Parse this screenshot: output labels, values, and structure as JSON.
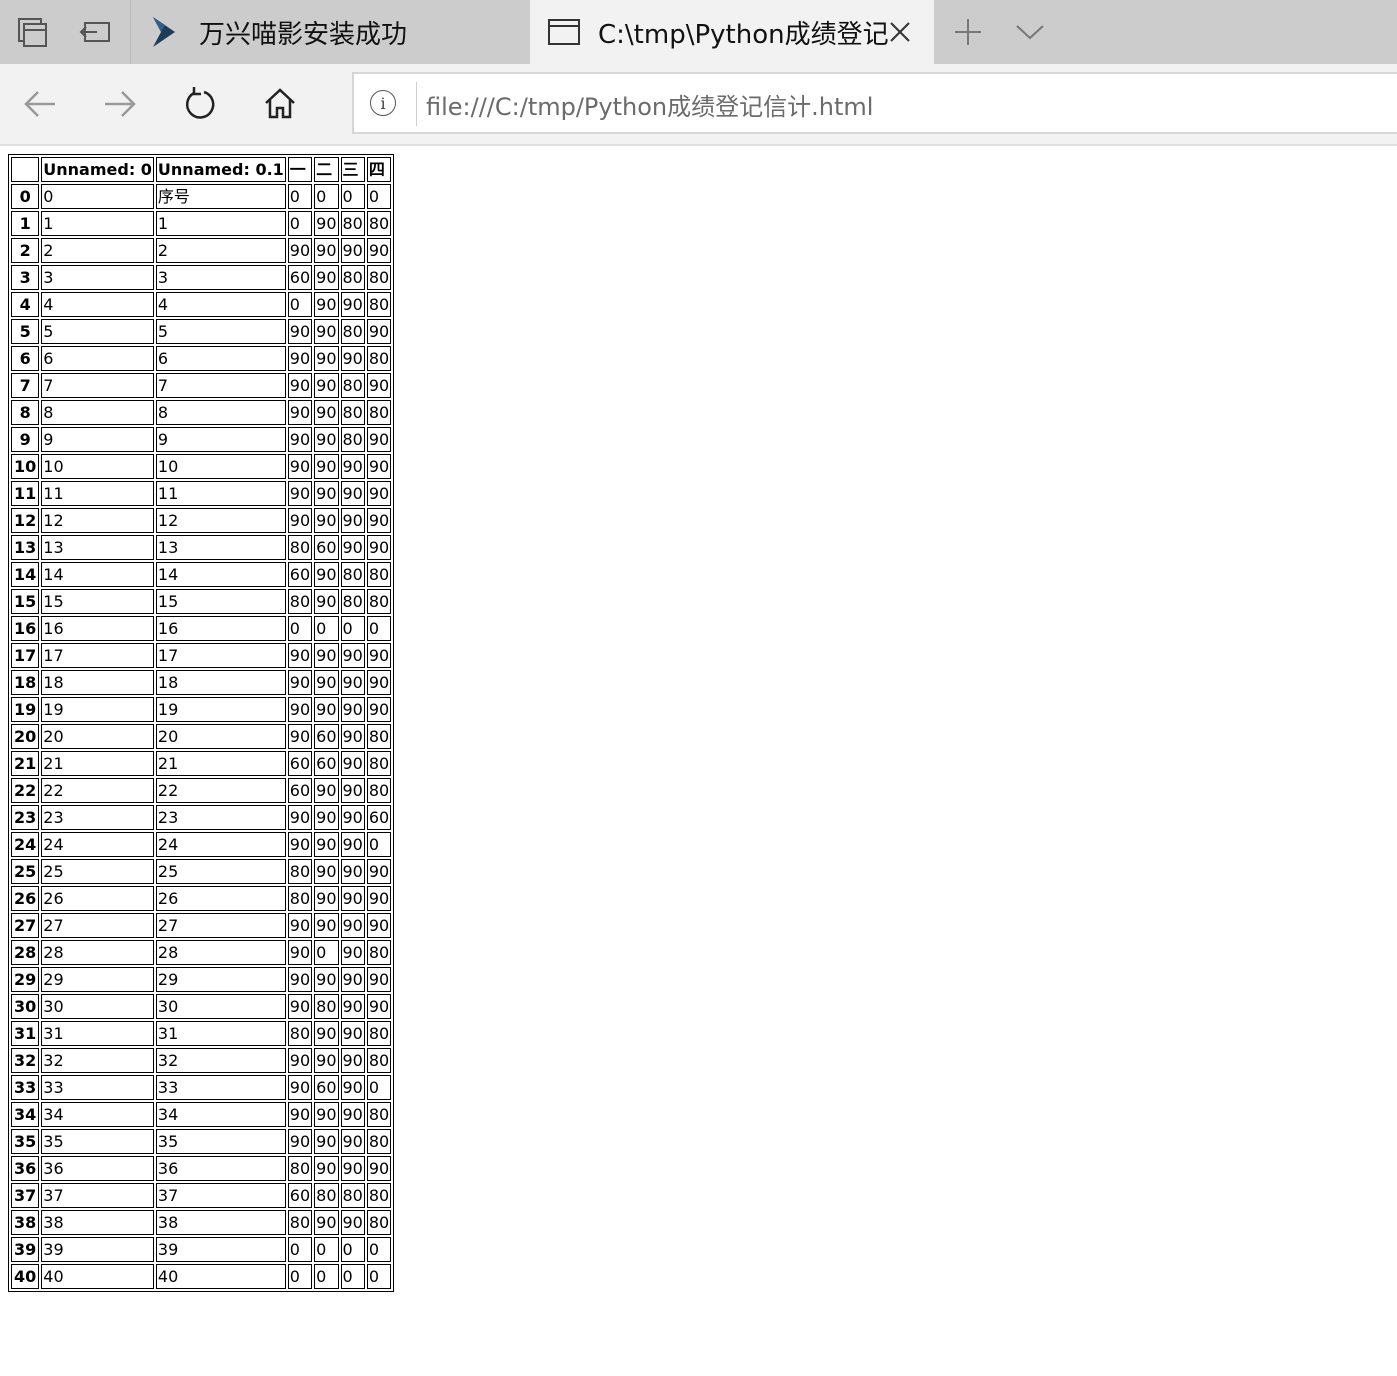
{
  "tabs": [
    {
      "title": "万兴喵影安装成功",
      "active": false,
      "icon": "filmora-logo-icon"
    },
    {
      "title": "C:\\tmp\\Python成绩登记",
      "active": true,
      "icon": "page-icon"
    }
  ],
  "address_bar": {
    "url": "file:///C:/tmp/Python成绩登记信计.html"
  },
  "table": {
    "columns": [
      "",
      "Unnamed: 0",
      "Unnamed: 0.1",
      "一",
      "二",
      "三",
      "四"
    ],
    "rows": [
      [
        "0",
        "0",
        "序号",
        "0",
        "0",
        "0",
        "0"
      ],
      [
        "1",
        "1",
        "1",
        "0",
        "90",
        "80",
        "80"
      ],
      [
        "2",
        "2",
        "2",
        "90",
        "90",
        "90",
        "90"
      ],
      [
        "3",
        "3",
        "3",
        "60",
        "90",
        "80",
        "80"
      ],
      [
        "4",
        "4",
        "4",
        "0",
        "90",
        "90",
        "80"
      ],
      [
        "5",
        "5",
        "5",
        "90",
        "90",
        "80",
        "90"
      ],
      [
        "6",
        "6",
        "6",
        "90",
        "90",
        "90",
        "80"
      ],
      [
        "7",
        "7",
        "7",
        "90",
        "90",
        "80",
        "90"
      ],
      [
        "8",
        "8",
        "8",
        "90",
        "90",
        "80",
        "80"
      ],
      [
        "9",
        "9",
        "9",
        "90",
        "90",
        "80",
        "90"
      ],
      [
        "10",
        "10",
        "10",
        "90",
        "90",
        "90",
        "90"
      ],
      [
        "11",
        "11",
        "11",
        "90",
        "90",
        "90",
        "90"
      ],
      [
        "12",
        "12",
        "12",
        "90",
        "90",
        "90",
        "90"
      ],
      [
        "13",
        "13",
        "13",
        "80",
        "60",
        "90",
        "90"
      ],
      [
        "14",
        "14",
        "14",
        "60",
        "90",
        "80",
        "80"
      ],
      [
        "15",
        "15",
        "15",
        "80",
        "90",
        "80",
        "80"
      ],
      [
        "16",
        "16",
        "16",
        "0",
        "0",
        "0",
        "0"
      ],
      [
        "17",
        "17",
        "17",
        "90",
        "90",
        "90",
        "90"
      ],
      [
        "18",
        "18",
        "18",
        "90",
        "90",
        "90",
        "90"
      ],
      [
        "19",
        "19",
        "19",
        "90",
        "90",
        "90",
        "90"
      ],
      [
        "20",
        "20",
        "20",
        "90",
        "60",
        "90",
        "80"
      ],
      [
        "21",
        "21",
        "21",
        "60",
        "60",
        "90",
        "80"
      ],
      [
        "22",
        "22",
        "22",
        "60",
        "90",
        "90",
        "80"
      ],
      [
        "23",
        "23",
        "23",
        "90",
        "90",
        "90",
        "60"
      ],
      [
        "24",
        "24",
        "24",
        "90",
        "90",
        "90",
        "0"
      ],
      [
        "25",
        "25",
        "25",
        "80",
        "90",
        "90",
        "90"
      ],
      [
        "26",
        "26",
        "26",
        "80",
        "90",
        "90",
        "90"
      ],
      [
        "27",
        "27",
        "27",
        "90",
        "90",
        "90",
        "90"
      ],
      [
        "28",
        "28",
        "28",
        "90",
        "0",
        "90",
        "80"
      ],
      [
        "29",
        "29",
        "29",
        "90",
        "90",
        "90",
        "90"
      ],
      [
        "30",
        "30",
        "30",
        "90",
        "80",
        "90",
        "90"
      ],
      [
        "31",
        "31",
        "31",
        "80",
        "90",
        "90",
        "80"
      ],
      [
        "32",
        "32",
        "32",
        "90",
        "90",
        "90",
        "80"
      ],
      [
        "33",
        "33",
        "33",
        "90",
        "60",
        "90",
        "0"
      ],
      [
        "34",
        "34",
        "34",
        "90",
        "90",
        "90",
        "80"
      ],
      [
        "35",
        "35",
        "35",
        "90",
        "90",
        "90",
        "80"
      ],
      [
        "36",
        "36",
        "36",
        "80",
        "90",
        "90",
        "90"
      ],
      [
        "37",
        "37",
        "37",
        "60",
        "80",
        "80",
        "80"
      ],
      [
        "38",
        "38",
        "38",
        "80",
        "90",
        "90",
        "80"
      ],
      [
        "39",
        "39",
        "39",
        "0",
        "0",
        "0",
        "0"
      ],
      [
        "40",
        "40",
        "40",
        "0",
        "0",
        "0",
        "0"
      ]
    ]
  }
}
